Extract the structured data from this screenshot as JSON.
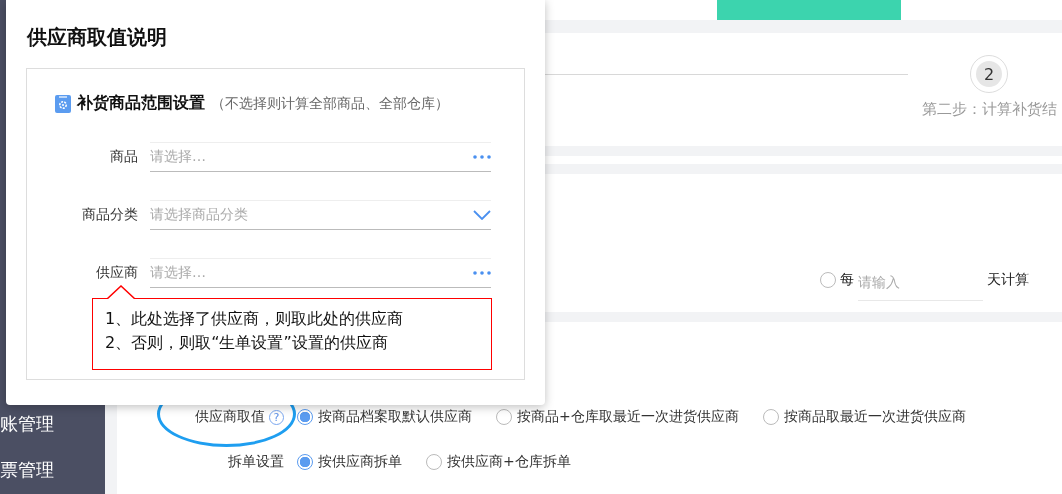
{
  "sidebar": {
    "items": [
      {
        "label": "账管理"
      },
      {
        "label": "票管理"
      }
    ]
  },
  "tabs": [
    {
      "selected": false
    },
    {
      "selected": true
    }
  ],
  "steps": [
    {
      "number": "2",
      "label": "第二步：计算补货结"
    }
  ],
  "period_option": {
    "selected": false,
    "prefix": "每",
    "placeholder": "请输入",
    "suffix": "天计算"
  },
  "settings": [
    {
      "label": "供应商取值",
      "help": "?",
      "highlighted": true,
      "options": [
        {
          "label": "按商品档案取默认供应商",
          "selected": true
        },
        {
          "label": "按商品+仓库取最近一次进货供应商",
          "selected": false
        },
        {
          "label": "按商品取最近一次进货供应商",
          "selected": false
        }
      ]
    },
    {
      "label": "拆单设置",
      "options": [
        {
          "label": "按供应商拆单",
          "selected": true
        },
        {
          "label": "按供应商+仓库拆单",
          "selected": false
        }
      ]
    }
  ],
  "dialog": {
    "title": "供应商取值说明",
    "section": {
      "title": "补货商品范围设置",
      "note": "（不选择则计算全部商品、全部仓库）",
      "fields": [
        {
          "label": "商品",
          "placeholder": "请选择…",
          "kind": "picker"
        },
        {
          "label": "商品分类",
          "placeholder": "请选择商品分类",
          "kind": "dropdown"
        },
        {
          "label": "供应商",
          "placeholder": "请选择…",
          "kind": "picker"
        }
      ]
    },
    "callout": [
      "1、此处选择了供应商，则取此处的供应商",
      "2、否则，则取“生单设置”设置的供应商"
    ]
  }
}
